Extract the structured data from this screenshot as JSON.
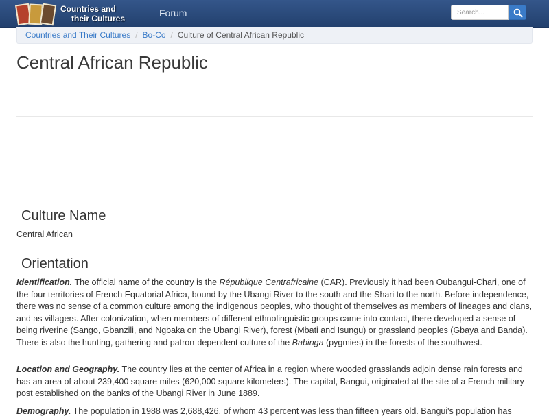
{
  "navbar": {
    "logo_line1": "Countries and",
    "logo_line2": "their Cultures",
    "forum_label": "Forum",
    "search_placeholder": "Search...",
    "search_icon": "search-icon",
    "color": "#2b4a78",
    "accent": "#3a7bc8"
  },
  "breadcrumb": {
    "items": [
      "Countries and Their Cultures",
      "Bo-Co"
    ],
    "current": "Culture of Central African Republic"
  },
  "page": {
    "title": "Central African Republic",
    "culture_name_heading": "Culture Name",
    "culture_name": "Central African",
    "orientation_heading": "Orientation",
    "identification": {
      "label": "Identification.",
      "t1": " The official name of the country is the ",
      "e1": "République Centrafricaine",
      "t2": " (CAR). Previously it had been Oubangui-Chari, one of the four territories of French Equatorial Africa, bound by the Ubangi River to the south and the Shari to the north. Before independence, there was no sense of a common culture among the indigenous peoples, who thought of themselves as members of lineages and clans, and as villagers. After colonization, when members of different ethnolinguistic groups came into contact, there developed a sense of being riverine (Sango, Gbanzili, and Ngbaka on the Ubangi River), forest (Mbati and Isungu) or grassland peoples (Gbaya and Banda). There is also the hunting, gathering and patron-dependent culture of the ",
      "e2": "Babinga",
      "t3": " (pygmies) in the forests of the southwest."
    },
    "location": {
      "label": "Location and Geography.",
      "text": " The country lies at the center of Africa in a region where wooded grasslands adjoin dense rain forests and has an area of about 239,400 square miles (620,000 square kilometers). The capital, Bangui, originated at the site of a French military post established on the banks of the Ubangi River in June 1889."
    },
    "demography": {
      "label": "Demography.",
      "text": " The population in 1988 was 2,688,426, of whom 43 percent was less than fifteen years old. Bangui's population has"
    }
  }
}
